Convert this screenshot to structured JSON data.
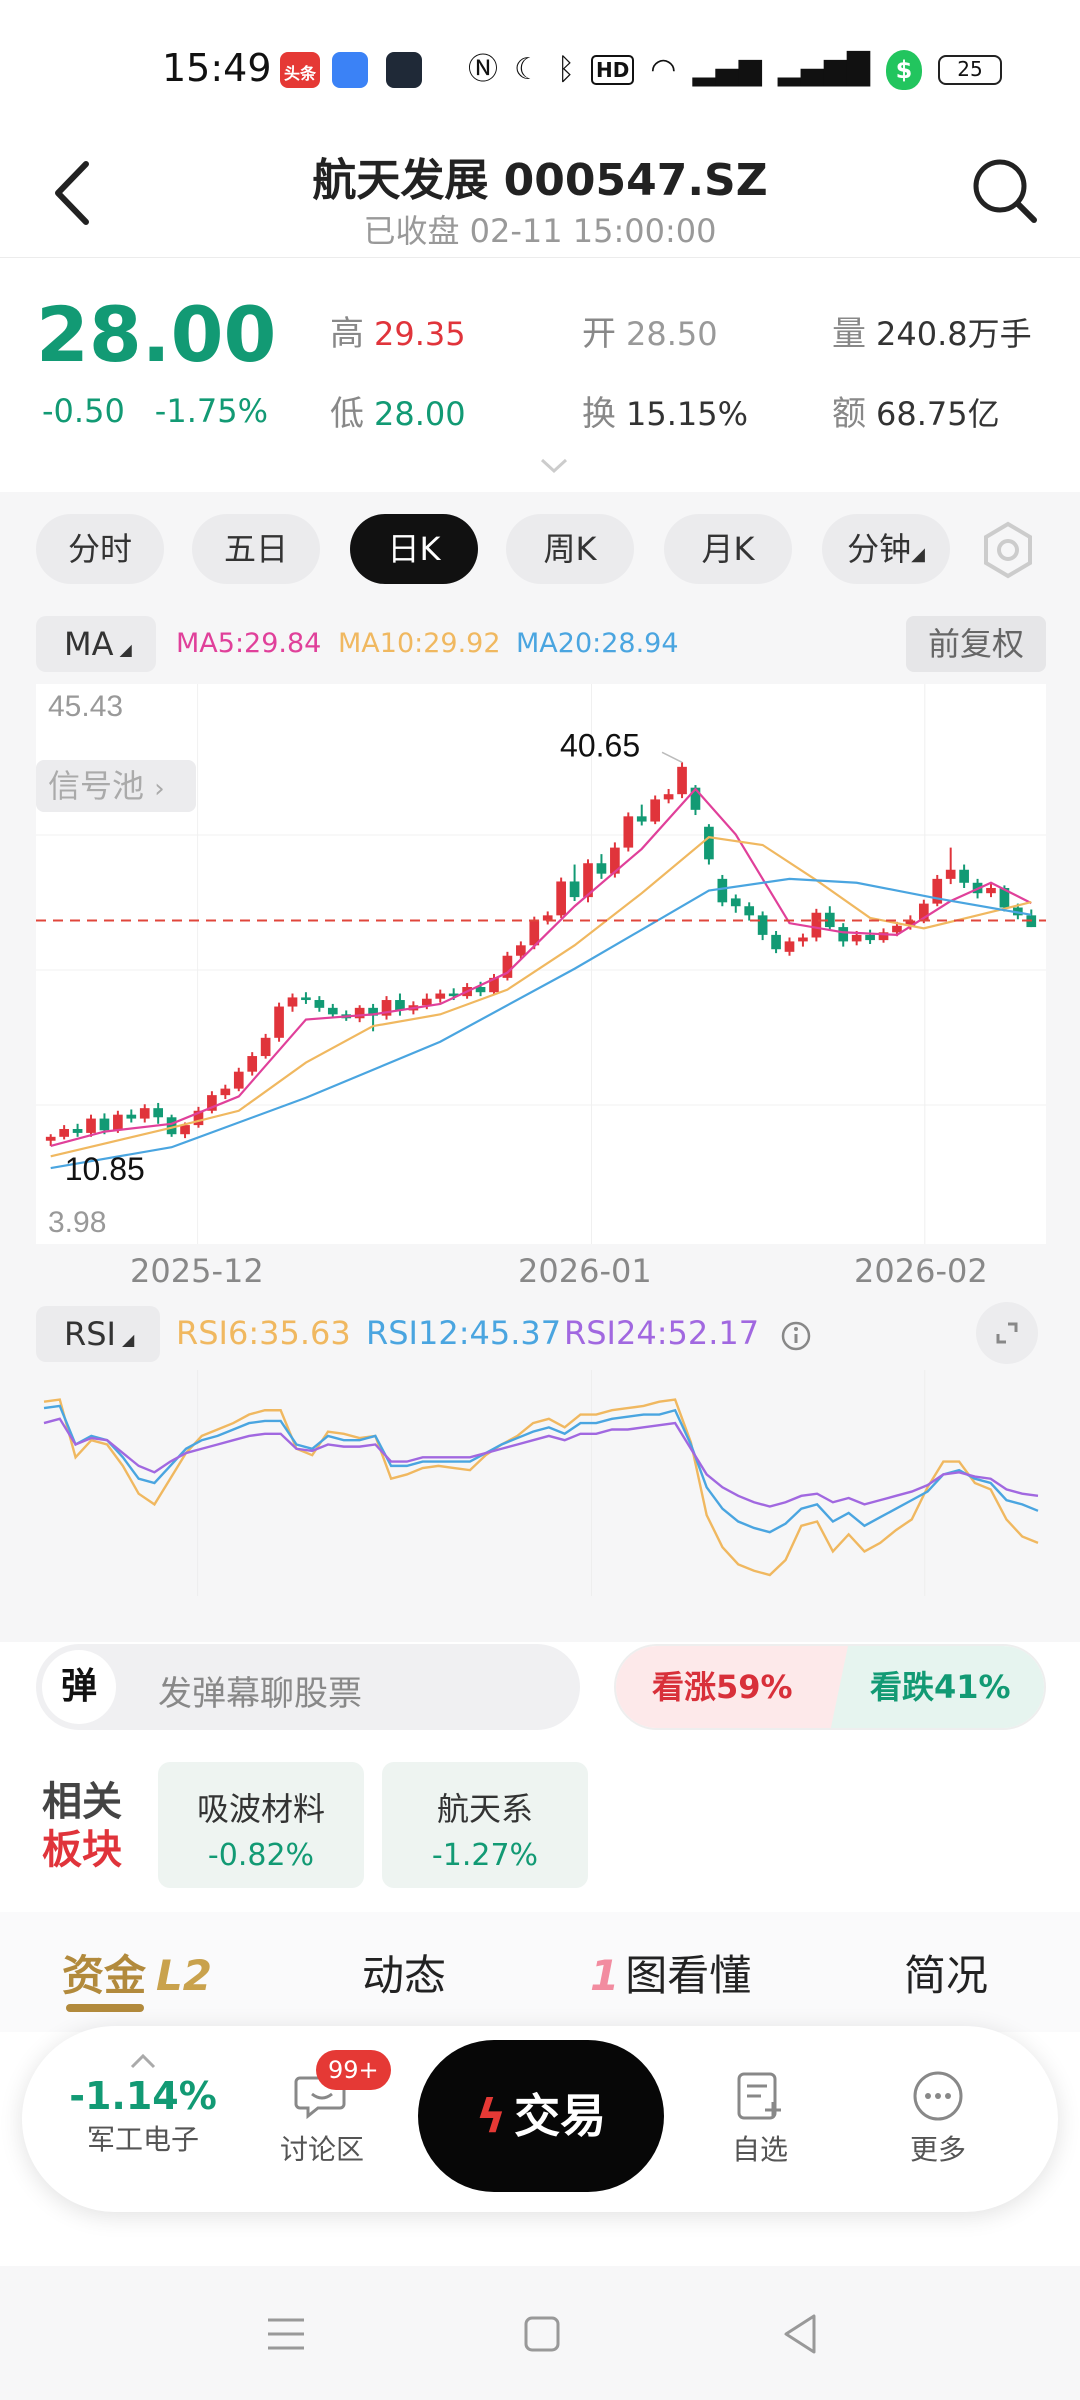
{
  "status_bar": {
    "time": "15:49",
    "apps": [
      {
        "name": "toutiao-icon",
        "text": "头条"
      },
      {
        "name": "blue-app-icon"
      },
      {
        "name": "mail-app-icon"
      }
    ],
    "battery": "25"
  },
  "header": {
    "title": "航天发展 000547.SZ",
    "subtitle": "已收盘 02-11 15:00:00"
  },
  "quote": {
    "price": "28.00",
    "change": "-0.50",
    "change_pct": "-1.75%",
    "high_label": "高",
    "high": "29.35",
    "low_label": "低",
    "low": "28.00",
    "open_label": "开",
    "open": "28.50",
    "turnover_label": "换",
    "turnover": "15.15%",
    "volume_label": "量",
    "volume": "240.8万手",
    "amount_label": "额",
    "amount": "68.75亿"
  },
  "kline_tabs": [
    {
      "label": "分时",
      "active": false
    },
    {
      "label": "五日",
      "active": false
    },
    {
      "label": "日K",
      "active": true
    },
    {
      "label": "周K",
      "active": false
    },
    {
      "label": "月K",
      "active": false
    },
    {
      "label": "分钟",
      "active": false
    }
  ],
  "ma": {
    "selector": "MA",
    "ma5": "MA5:29.84",
    "ma10": "MA10:29.92",
    "ma20": "MA20:28.94",
    "adjust": "前复权",
    "colors": {
      "ma5": "#e0409a",
      "ma10": "#f0b860",
      "ma20": "#4aa5e0"
    }
  },
  "signal_pool": "信号池",
  "chart_data": [
    {
      "type": "candlestick",
      "title": "",
      "y_top_label": "45.43",
      "y_bottom_label": "3.98",
      "max_label": "40.65",
      "min_label": "10.85",
      "reference_price": 28.5,
      "x_tick_labels": [
        "2025-12",
        "2026-01",
        "2026-02"
      ],
      "ylim": [
        3.98,
        45.43
      ],
      "candles": [
        [
          11.6,
          11.9,
          12.1,
          11.2
        ],
        [
          11.9,
          12.5,
          12.8,
          11.7
        ],
        [
          12.5,
          12.2,
          12.9,
          11.9
        ],
        [
          12.2,
          13.3,
          13.6,
          11.9
        ],
        [
          13.3,
          12.4,
          13.7,
          12.1
        ],
        [
          12.4,
          13.6,
          13.9,
          12.2
        ],
        [
          13.6,
          13.3,
          14.0,
          13.0
        ],
        [
          13.3,
          14.1,
          14.4,
          13.0
        ],
        [
          14.1,
          13.4,
          14.5,
          12.9
        ],
        [
          13.4,
          12.1,
          13.6,
          11.9
        ],
        [
          12.1,
          12.8,
          13.0,
          11.8
        ],
        [
          12.8,
          13.9,
          14.2,
          12.6
        ],
        [
          13.9,
          15.1,
          15.4,
          13.7
        ],
        [
          15.1,
          15.6,
          15.9,
          14.8
        ],
        [
          15.6,
          16.9,
          17.2,
          15.4
        ],
        [
          16.9,
          18.1,
          18.4,
          16.6
        ],
        [
          18.1,
          19.5,
          19.8,
          17.9
        ],
        [
          19.5,
          21.9,
          22.2,
          19.2
        ],
        [
          21.9,
          22.6,
          22.9,
          21.5
        ],
        [
          22.6,
          22.4,
          23.0,
          22.1
        ],
        [
          22.4,
          21.8,
          22.7,
          21.5
        ],
        [
          21.8,
          21.3,
          22.1,
          21.0
        ],
        [
          21.3,
          21.0,
          21.6,
          20.8
        ],
        [
          21.0,
          21.8,
          22.0,
          20.7
        ],
        [
          21.8,
          21.2,
          22.1,
          20.0
        ],
        [
          21.2,
          22.4,
          22.7,
          20.9
        ],
        [
          22.4,
          21.6,
          22.9,
          21.2
        ],
        [
          21.6,
          22.0,
          22.3,
          21.3
        ],
        [
          22.0,
          22.5,
          22.9,
          21.7
        ],
        [
          22.5,
          22.9,
          23.2,
          22.2
        ],
        [
          22.9,
          22.7,
          23.3,
          22.4
        ],
        [
          22.7,
          23.4,
          23.7,
          22.5
        ],
        [
          23.4,
          23.0,
          23.8,
          22.7
        ],
        [
          23.0,
          24.1,
          24.4,
          22.8
        ],
        [
          24.1,
          25.8,
          26.1,
          23.9
        ],
        [
          25.8,
          26.6,
          26.9,
          25.5
        ],
        [
          26.6,
          28.5,
          28.8,
          26.3
        ],
        [
          28.5,
          28.9,
          29.2,
          28.2
        ],
        [
          28.9,
          31.5,
          31.8,
          28.7
        ],
        [
          31.5,
          30.3,
          32.8,
          30.0
        ],
        [
          30.3,
          32.9,
          33.2,
          29.9
        ],
        [
          32.9,
          32.1,
          33.6,
          31.7
        ],
        [
          32.1,
          34.1,
          34.5,
          31.8
        ],
        [
          34.1,
          36.5,
          36.8,
          33.8
        ],
        [
          36.5,
          36.1,
          37.4,
          35.8
        ],
        [
          36.1,
          37.8,
          38.1,
          35.9
        ],
        [
          37.8,
          38.2,
          38.6,
          37.5
        ],
        [
          38.2,
          40.3,
          40.65,
          37.9
        ],
        [
          38.7,
          37.0,
          38.9,
          36.6
        ],
        [
          35.7,
          33.2,
          35.9,
          32.8
        ],
        [
          31.7,
          29.9,
          32.0,
          29.6
        ],
        [
          30.2,
          29.6,
          30.5,
          29.1
        ],
        [
          29.6,
          28.9,
          29.9,
          28.5
        ],
        [
          28.9,
          27.4,
          29.2,
          27.0
        ],
        [
          27.4,
          26.3,
          27.7,
          26.0
        ],
        [
          26.1,
          26.9,
          27.2,
          25.8
        ],
        [
          26.9,
          27.2,
          27.5,
          26.5
        ],
        [
          27.2,
          29.1,
          29.4,
          26.9
        ],
        [
          29.1,
          28.0,
          29.6,
          27.7
        ],
        [
          28.0,
          26.9,
          28.3,
          26.5
        ],
        [
          26.9,
          27.4,
          27.7,
          26.6
        ],
        [
          27.4,
          27.0,
          27.8,
          26.7
        ],
        [
          27.0,
          27.6,
          27.9,
          26.8
        ],
        [
          27.6,
          28.1,
          28.4,
          27.3
        ],
        [
          28.1,
          28.5,
          28.9,
          27.8
        ],
        [
          28.5,
          29.8,
          30.1,
          28.3
        ],
        [
          29.8,
          31.7,
          32.0,
          29.6
        ],
        [
          31.7,
          32.4,
          34.1,
          31.3
        ],
        [
          32.4,
          31.4,
          32.8,
          31.0
        ],
        [
          31.4,
          30.6,
          31.7,
          30.2
        ],
        [
          30.6,
          31.0,
          31.3,
          30.3
        ],
        [
          31.0,
          29.5,
          31.2,
          29.2
        ],
        [
          29.5,
          28.9,
          29.8,
          28.6
        ],
        [
          28.9,
          28.0,
          29.35,
          28.0
        ]
      ],
      "ma_lines_approx": {
        "ma5": [
          [
            0,
            11.2
          ],
          [
            4,
            12.3
          ],
          [
            9,
            12.9
          ],
          [
            14,
            15.0
          ],
          [
            19,
            20.9
          ],
          [
            24,
            21.3
          ],
          [
            29,
            22.1
          ],
          [
            34,
            24.5
          ],
          [
            39,
            29.6
          ],
          [
            44,
            34.0
          ],
          [
            48,
            38.6
          ],
          [
            51,
            35.1
          ],
          [
            55,
            28.3
          ],
          [
            59,
            27.6
          ],
          [
            63,
            27.4
          ],
          [
            67,
            30.0
          ],
          [
            70,
            31.4
          ],
          [
            73,
            29.84
          ]
        ],
        "ma10": [
          [
            0,
            10.4
          ],
          [
            9,
            12.6
          ],
          [
            14,
            13.9
          ],
          [
            19,
            17.6
          ],
          [
            24,
            20.4
          ],
          [
            29,
            21.3
          ],
          [
            34,
            23.2
          ],
          [
            39,
            26.6
          ],
          [
            44,
            30.6
          ],
          [
            49,
            34.9
          ],
          [
            53,
            34.3
          ],
          [
            57,
            31.6
          ],
          [
            61,
            28.7
          ],
          [
            65,
            27.9
          ],
          [
            69,
            28.9
          ],
          [
            73,
            29.92
          ]
        ],
        "ma20": [
          [
            0,
            9.5
          ],
          [
            9,
            11.1
          ],
          [
            19,
            14.9
          ],
          [
            29,
            19.2
          ],
          [
            39,
            24.8
          ],
          [
            49,
            30.8
          ],
          [
            55,
            31.7
          ],
          [
            60,
            31.4
          ],
          [
            66,
            30.2
          ],
          [
            73,
            28.94
          ]
        ]
      }
    },
    {
      "type": "line",
      "title": "",
      "ylim": [
        0,
        100
      ],
      "series": [
        {
          "name": "RSI6",
          "value_label": "RSI6:35.63",
          "color": "#f0b860",
          "values": [
            88,
            89,
            62,
            70,
            68,
            58,
            45,
            40,
            52,
            64,
            72,
            75,
            78,
            82,
            84,
            84,
            66,
            63,
            74,
            73,
            71,
            72,
            52,
            54,
            57,
            58,
            57,
            56,
            63,
            68,
            72,
            78,
            80,
            76,
            82,
            82,
            84,
            85,
            86,
            88,
            89,
            69,
            35,
            20,
            12,
            9,
            7,
            14,
            30,
            32,
            18,
            26,
            18,
            22,
            28,
            33,
            48,
            60,
            60,
            50,
            47,
            33,
            25,
            22
          ]
        },
        {
          "name": "RSI12",
          "value_label": "RSI12:45.37",
          "color": "#4aa5e0",
          "values": [
            85,
            86,
            68,
            72,
            70,
            62,
            52,
            50,
            58,
            66,
            70,
            72,
            75,
            78,
            79,
            79,
            68,
            66,
            72,
            70,
            70,
            72,
            58,
            58,
            60,
            60,
            60,
            60,
            64,
            68,
            71,
            74,
            76,
            73,
            78,
            78,
            80,
            81,
            82,
            82,
            84,
            68,
            48,
            38,
            32,
            29,
            27,
            31,
            38,
            40,
            32,
            36,
            30,
            34,
            38,
            42,
            46,
            54,
            56,
            52,
            50,
            42,
            40,
            37
          ]
        },
        {
          "name": "RSI24",
          "value_label": "RSI24:52.17",
          "color": "#a168e0",
          "values": [
            78,
            80,
            68,
            71,
            70,
            64,
            58,
            55,
            60,
            64,
            66,
            68,
            70,
            72,
            73,
            73,
            66,
            65,
            68,
            67,
            67,
            68,
            60,
            60,
            62,
            62,
            62,
            62,
            64,
            66,
            68,
            70,
            72,
            70,
            73,
            73,
            75,
            75,
            76,
            77,
            78,
            66,
            54,
            48,
            44,
            41,
            39,
            41,
            44,
            45,
            41,
            43,
            40,
            42,
            44,
            46,
            49,
            54,
            55,
            53,
            52,
            47,
            45,
            44
          ]
        }
      ]
    }
  ],
  "rsi": {
    "selector": "RSI",
    "rsi6": "RSI6:35.63",
    "rsi12": "RSI12:45.37",
    "rsi24": "RSI24:52.17",
    "colors": {
      "rsi6": "#f0b860",
      "rsi12": "#4aa5e0",
      "rsi24": "#a168e0"
    }
  },
  "danmu": {
    "badge": "弹",
    "placeholder": "发弹幕聊股票",
    "bull": "看涨",
    "bull_pct": "59%",
    "bear": "看跌",
    "bear_pct": "41%"
  },
  "sectors": {
    "label_line1": "相关",
    "label_line2": "板块",
    "items": [
      {
        "name": "吸波材料",
        "value": "-0.82%"
      },
      {
        "name": "航天系",
        "value": "-1.27%"
      }
    ]
  },
  "bottom_tabs": [
    {
      "label": "资金",
      "suffix": "L2",
      "active": true
    },
    {
      "label": "动态",
      "active": false
    },
    {
      "label": "图看懂",
      "prefix": "1",
      "active": false
    },
    {
      "label": "简况",
      "active": false
    }
  ],
  "action_bar": {
    "sector_pct": "-1.14%",
    "sector_name": "军工电子",
    "discuss": "讨论区",
    "discuss_badge": "99+",
    "trade": "交易",
    "watchlist": "自选",
    "more": "更多"
  },
  "colors": {
    "up": "#e0343b",
    "down": "#129a74",
    "accent_gold": "#b28a3c"
  }
}
